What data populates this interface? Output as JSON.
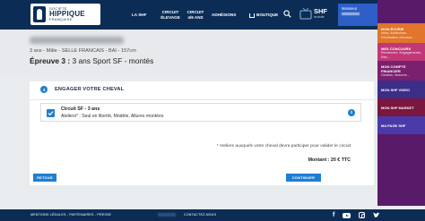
{
  "header": {
    "logo": {
      "line1": "SOCIÉTÉ",
      "line2": "HIPPIQUE",
      "line3": "FRANÇAISE"
    },
    "nav": [
      {
        "label": "LA SHF"
      },
      {
        "label": "CIRCUIT ÉLEVAGE"
      },
      {
        "label": "CIRCUIT 4/6 ANS"
      },
      {
        "label": "ADHÉSIONS"
      },
      {
        "label": "BOUTIQUE"
      }
    ],
    "shf_tv": {
      "label": "SHF",
      "sub": "mobile"
    },
    "user": {
      "greeting": "Monsieur"
    }
  },
  "side_menu": [
    {
      "title": "MON ÉCURIE",
      "sub": "Infos, Adhésions, Déclaration chevaux..."
    },
    {
      "title": "MES CONCOURS",
      "sub": "Recherche, Engagements, Rés..."
    },
    {
      "title": "MON COMPTE FINANCIER",
      "sub": "Gestion, factures..."
    },
    {
      "title": "MON SHF VIDEO"
    },
    {
      "title": "MON SHF MARKET"
    },
    {
      "title": "MA PAGE SHF"
    }
  ],
  "horse": {
    "meta": "3 ans - Mâle - SELLE FRANCAIS - BAI - 157cm",
    "epreuve_label": "Épreuve 3 :",
    "epreuve_value": " 3 ans Sport SF - montés"
  },
  "step": {
    "number": "4",
    "title": "ENGAGER VOTRE CHEVAL"
  },
  "option": {
    "title": "Circuit SF - 3 ans",
    "description": "Ateliers* : Seul en liberté, Modèle, Allures montées",
    "checked": true
  },
  "note": "* Ateliers auxquels votre cheval devra participer pour valider le circuit",
  "amount": "Montant : 20 € TTC",
  "buttons": {
    "back": "RETOUR",
    "next": "CONTINUER"
  },
  "footer": {
    "legal": "MENTIONS LÉGALES - PARTENAIRES - PRESSE",
    "contact": "CONTACTEZ-NOUS",
    "social": [
      "facebook-icon",
      "youtube-icon",
      "instagram-icon",
      "twitter-icon"
    ]
  },
  "colors": {
    "navy": "#0b2d55",
    "accent_blue": "#1e7fd0",
    "user_blue": "#2d5fc7",
    "side_orange": "#e0752b",
    "side_pink": "#c03878",
    "side_plum": "#7b1f6f"
  }
}
